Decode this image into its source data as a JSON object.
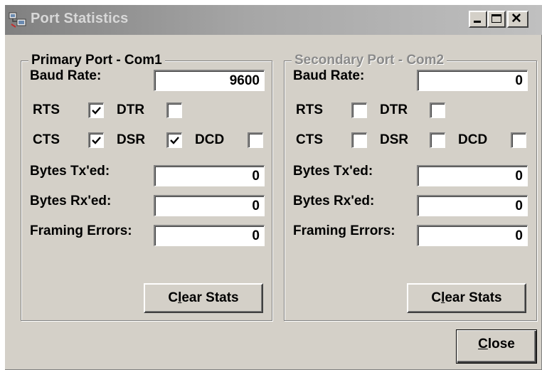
{
  "window": {
    "title": "Port Statistics",
    "min_glyph": "_",
    "close_glyph": "✕"
  },
  "primary": {
    "title": "Primary Port - Com1",
    "enabled": true,
    "baud_label": "Baud Rate:",
    "baud_value": "9600",
    "rts_label": "RTS",
    "rts_checked": true,
    "dtr_label": "DTR",
    "dtr_checked": false,
    "cts_label": "CTS",
    "cts_checked": true,
    "dsr_label": "DSR",
    "dsr_checked": true,
    "dcd_label": "DCD",
    "dcd_checked": false,
    "tx_label": "Bytes Tx'ed:",
    "tx_value": "0",
    "rx_label": "Bytes Rx'ed:",
    "rx_value": "0",
    "framing_label": "Framing Errors:",
    "framing_value": "0",
    "clear_pre": "C",
    "clear_accel": "l",
    "clear_post": "ear Stats"
  },
  "secondary": {
    "title": "Secondary Port - Com2",
    "enabled": false,
    "baud_label": "Baud Rate:",
    "baud_value": "0",
    "rts_label": "RTS",
    "rts_checked": false,
    "dtr_label": "DTR",
    "dtr_checked": false,
    "cts_label": "CTS",
    "cts_checked": false,
    "dsr_label": "DSR",
    "dsr_checked": false,
    "dcd_label": "DCD",
    "dcd_checked": false,
    "tx_label": "Bytes Tx'ed:",
    "tx_value": "0",
    "rx_label": "Bytes Rx'ed:",
    "rx_value": "0",
    "framing_label": "Framing Errors:",
    "framing_value": "0",
    "clear_pre": "C",
    "clear_accel": "l",
    "clear_post": "ear Stats"
  },
  "close_button": {
    "accel": "C",
    "rest": "lose"
  },
  "colors": {
    "face": "#d4d0c8",
    "title_bar_inactive_start": "#808080",
    "title_bar_inactive_end": "#c0c0c0",
    "disabled_text": "#8a8a8a"
  },
  "icons": {
    "app": "port-statistics-app-icon",
    "minimize": "minimize-icon",
    "maximize": "maximize-icon",
    "close": "close-icon",
    "check": "checkmark-icon"
  }
}
